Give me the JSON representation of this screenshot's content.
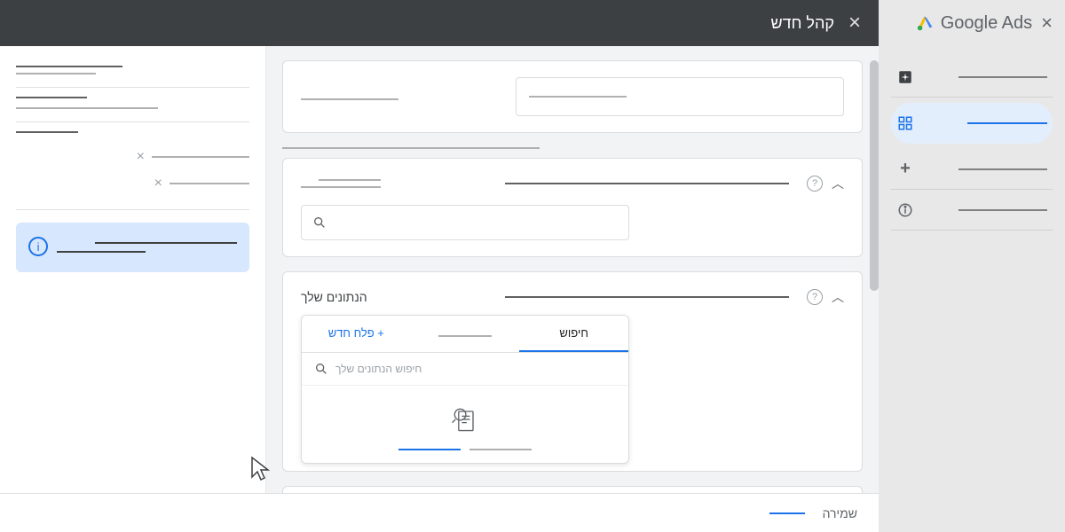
{
  "header": {
    "brand": "Google Ads",
    "modal_title": "קהל חדש"
  },
  "right_nav": {
    "items": [
      {
        "icon": "sparkle"
      },
      {
        "icon": "grid",
        "active": true
      },
      {
        "icon": "plus"
      },
      {
        "icon": "info"
      }
    ]
  },
  "your_data": {
    "title": "הנתונים שלך",
    "tabs": {
      "search": "חיפוש",
      "browse": "",
      "new_segment": "+ פלח חדש"
    },
    "search_placeholder": "חיפוש הנתונים שלך"
  },
  "footer": {
    "save": "שמירה"
  }
}
